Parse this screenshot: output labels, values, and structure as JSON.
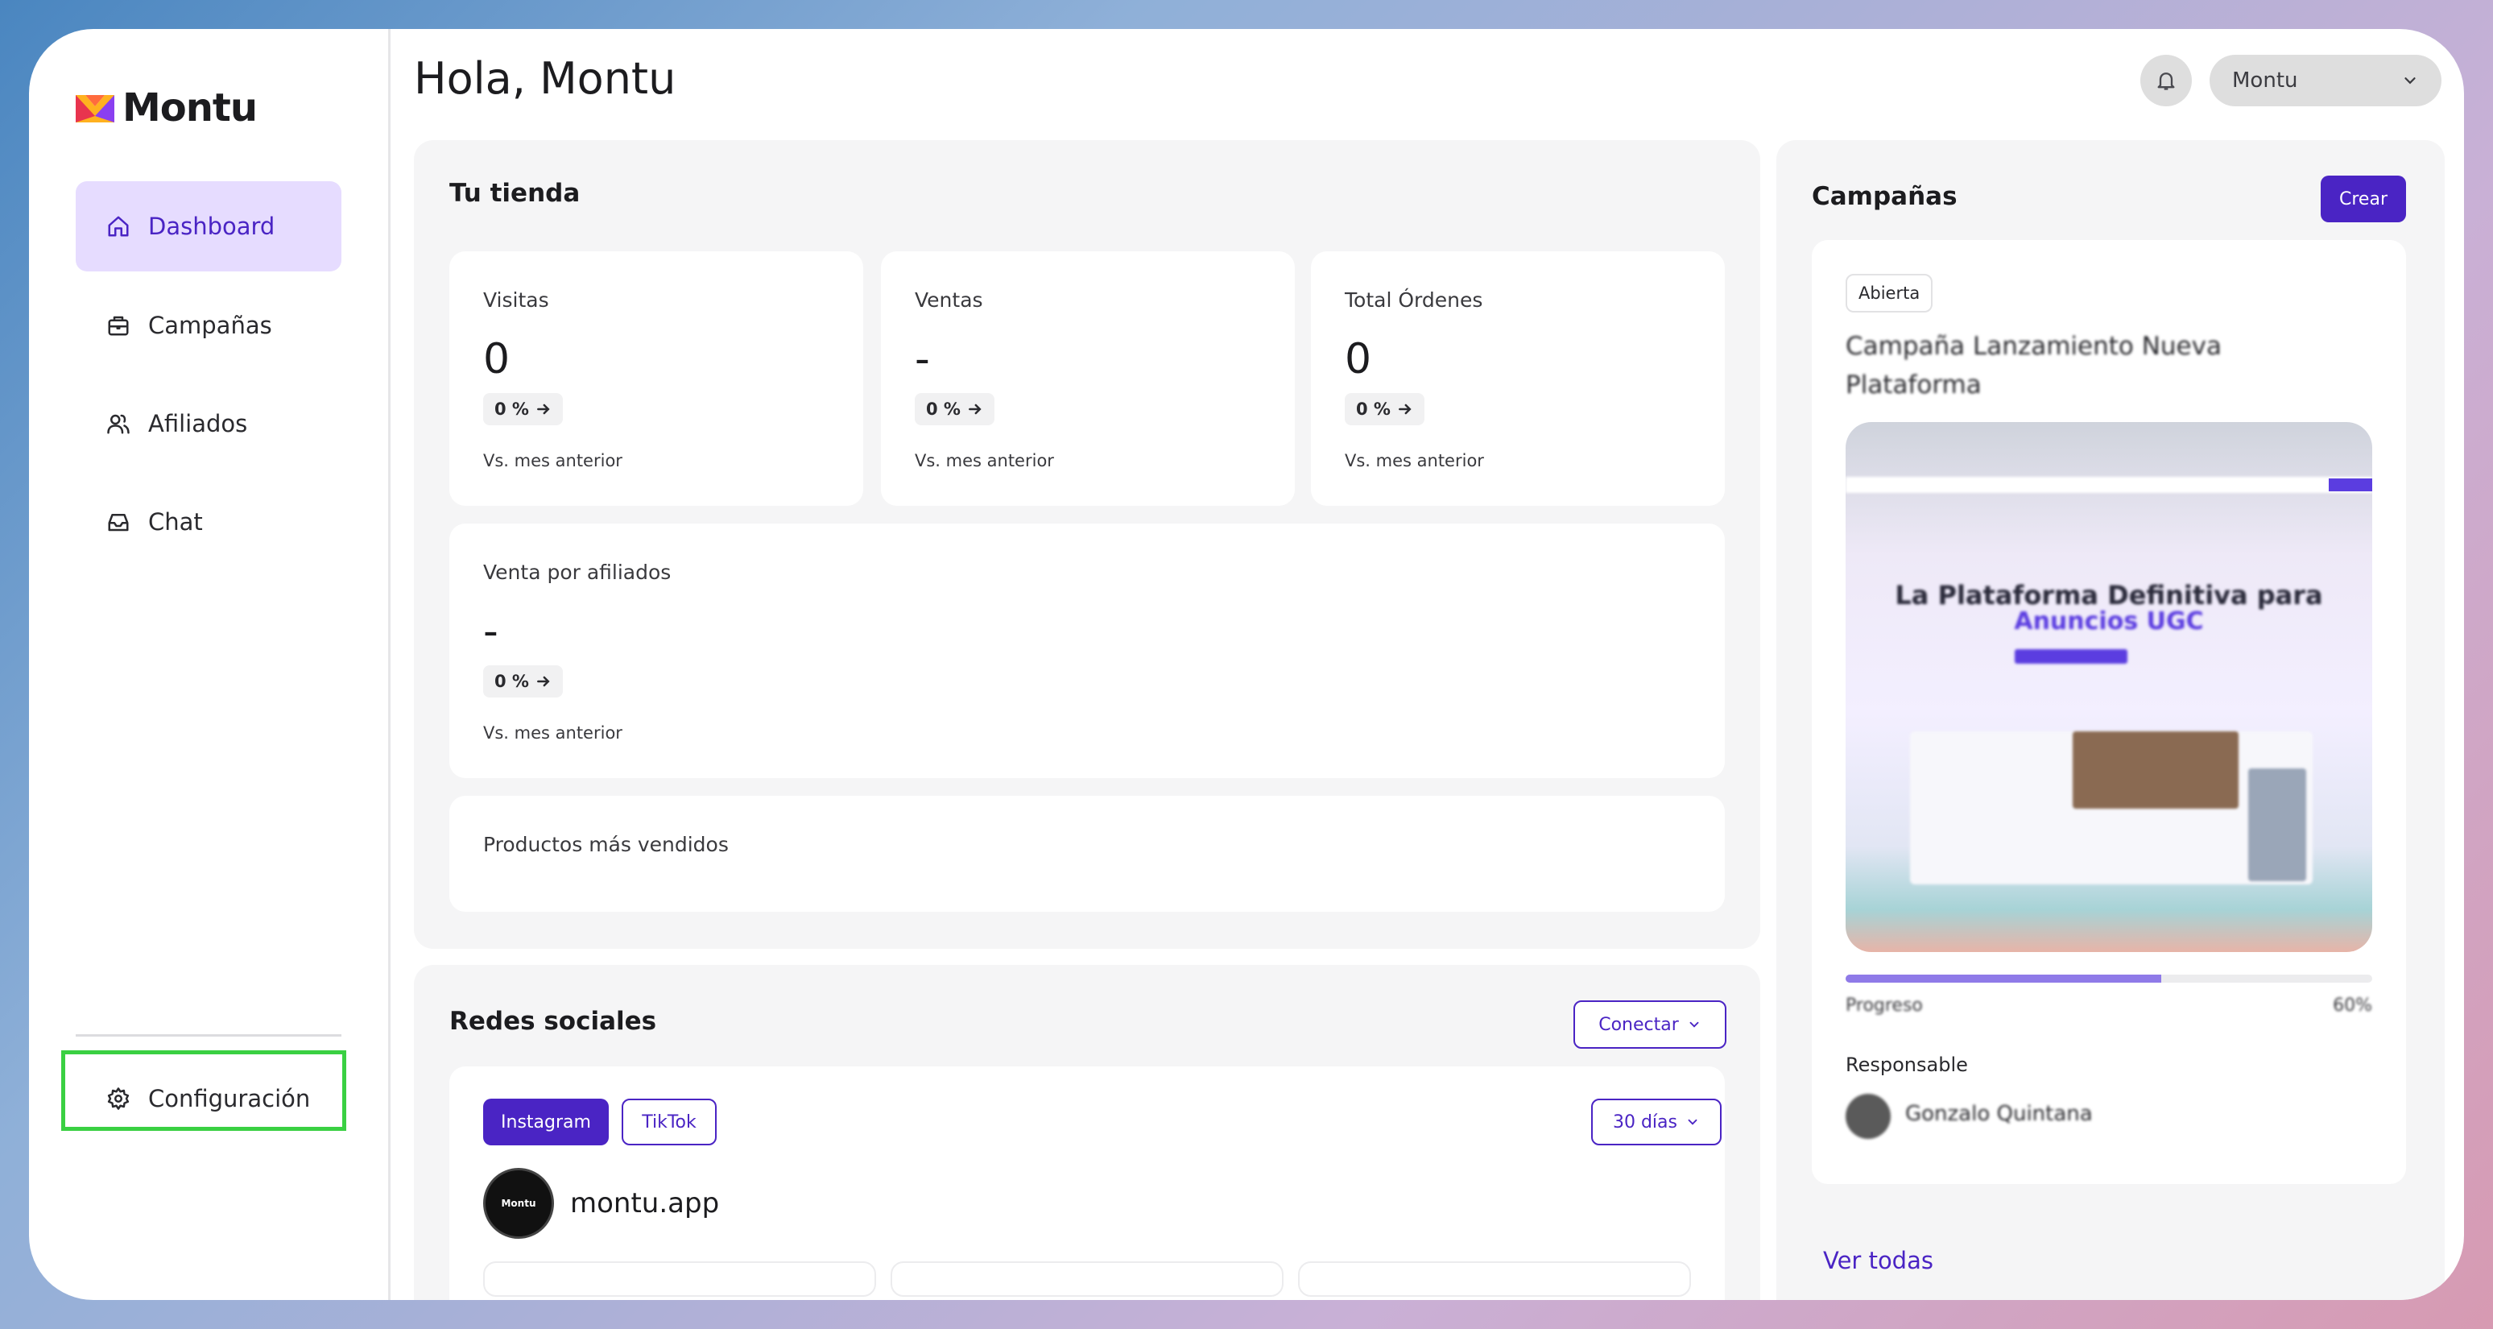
{
  "app": {
    "brand": "Montu"
  },
  "sidebar": {
    "items": [
      {
        "label": "Dashboard",
        "icon": "home-icon",
        "active": true
      },
      {
        "label": "Campañas",
        "icon": "briefcase-icon",
        "active": false
      },
      {
        "label": "Afiliados",
        "icon": "users-icon",
        "active": false
      },
      {
        "label": "Chat",
        "icon": "inbox-icon",
        "active": false
      }
    ],
    "settings": {
      "label": "Configuración",
      "icon": "gear-icon"
    }
  },
  "header": {
    "greeting": "Hola, Montu",
    "account": "Montu"
  },
  "store": {
    "title": "Tu tienda",
    "metrics": [
      {
        "label": "Visitas",
        "value": "0",
        "change": "0 %",
        "note": "Vs. mes anterior"
      },
      {
        "label": "Ventas",
        "value": "-",
        "change": "0 %",
        "note": "Vs. mes anterior"
      },
      {
        "label": "Total Órdenes",
        "value": "0",
        "change": "0 %",
        "note": "Vs. mes anterior"
      }
    ],
    "affiliate_sales": {
      "label": "Venta por afiliados",
      "value": "-",
      "change": "0 %",
      "note": "Vs. mes anterior"
    },
    "top_products": {
      "label": "Productos más vendidos"
    }
  },
  "social": {
    "title": "Redes sociales",
    "connect_label": "Conectar",
    "tabs": [
      "Instagram",
      "TikTok"
    ],
    "active_tab": "Instagram",
    "period": "30 días",
    "account_name": "montu.app",
    "avatar_text": "Montu"
  },
  "campaigns": {
    "title": "Campañas",
    "create_label": "Crear",
    "card": {
      "status": "Abierta",
      "name": "Campaña Lanzamiento Nueva Plataforma",
      "image_heading_1": "La Plataforma Definitiva para",
      "image_heading_2": "Anuncios UGC",
      "progress_label": "Progreso",
      "progress_value": "60%",
      "progress": 0.6,
      "responsible_label": "Responsable",
      "responsible_name": "Gonzalo Quintana"
    },
    "view_all": "Ver todas"
  },
  "colors": {
    "accent": "#4a24c4",
    "active_nav_bg": "#e6dcff",
    "highlight": "#3ad042"
  }
}
